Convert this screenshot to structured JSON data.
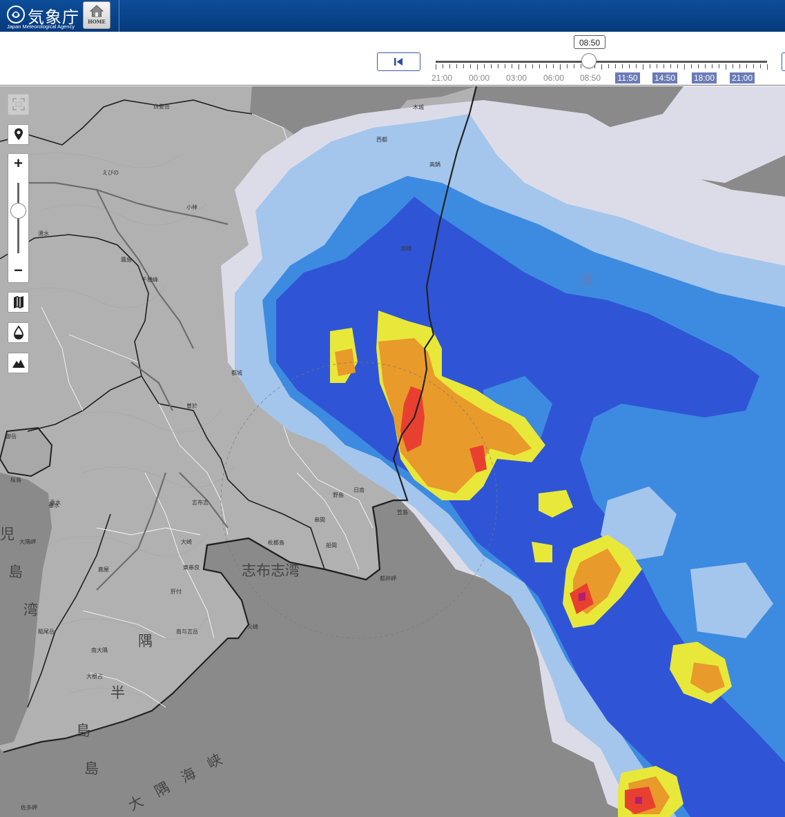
{
  "header": {
    "logo_jp": "気象庁",
    "logo_en": "Japan Meteorological Agency",
    "home_label": "HOME"
  },
  "timebar": {
    "current_time": "08:50",
    "labels": [
      {
        "text": "21:00",
        "forecast": false
      },
      {
        "text": "00:00",
        "forecast": false
      },
      {
        "text": "03:00",
        "forecast": false
      },
      {
        "text": "06:00",
        "forecast": false
      },
      {
        "text": "08:50",
        "forecast": false
      },
      {
        "text": "11:50",
        "forecast": true
      },
      {
        "text": "14:50",
        "forecast": true
      },
      {
        "text": "18:00",
        "forecast": true
      },
      {
        "text": "21:00",
        "forecast": true
      }
    ]
  },
  "map": {
    "big_labels": [
      "志布志湾",
      "大隅海峡",
      "灘"
    ],
    "vertical_labels": [
      "島",
      "湾",
      "隅",
      "半",
      "島",
      "島",
      "児"
    ],
    "place_labels": [
      "白髪岳",
      "えびの",
      "小林",
      "湧水",
      "霧島",
      "千穂峰",
      "曽於",
      "志布志",
      "大崎",
      "東串良",
      "肝付",
      "南大隅",
      "南与志岳",
      "都井岬",
      "串間",
      "垂水",
      "鹿屋",
      "桜島",
      "御岳",
      "大隅岬",
      "西都",
      "木城",
      "高鍋",
      "佐多岬",
      "垂水",
      "船間",
      "宮崎",
      "都城",
      "日南",
      "笠島",
      "枇榔島",
      "野島",
      "火崎",
      "大根占",
      "稲尾岳"
    ]
  },
  "colors": {
    "sea": "#8a8a8a",
    "land": "#b0b0b0",
    "rain_1": "#dcdce8",
    "rain_5": "#9ec3eb",
    "rain_10": "#3d8be0",
    "rain_20": "#2f5ad8",
    "rain_30": "#e8e83a",
    "rain_50": "#e89a2a",
    "rain_80": "#e84030",
    "rain_100": "#b0206e"
  }
}
